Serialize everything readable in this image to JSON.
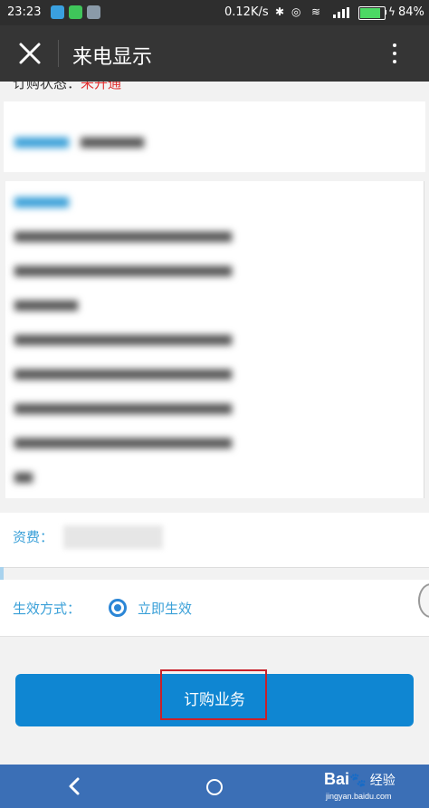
{
  "status_bar": {
    "time": "23:23",
    "network_speed": "0.12K/s",
    "battery_percent": "84%",
    "battery_level": 0.84
  },
  "title_bar": {
    "title": "来电显示"
  },
  "content": {
    "subscription_status": {
      "label": "订购状态：",
      "value": "未开通"
    },
    "fee": {
      "label": "资费："
    },
    "effect": {
      "label": "生效方式：",
      "option": "立即生效"
    },
    "order_button": "订购业务"
  },
  "watermark": {
    "brand": "Bai",
    "paw": "🐾",
    "cn": "经验",
    "url": "jingyan.baidu.com"
  },
  "colors": {
    "accent_blue": "#3aa0d8",
    "button_blue": "#0f86d2",
    "status_red": "#e03030",
    "nav_blue": "#3b6fb6",
    "highlight_red": "#c8212a"
  }
}
